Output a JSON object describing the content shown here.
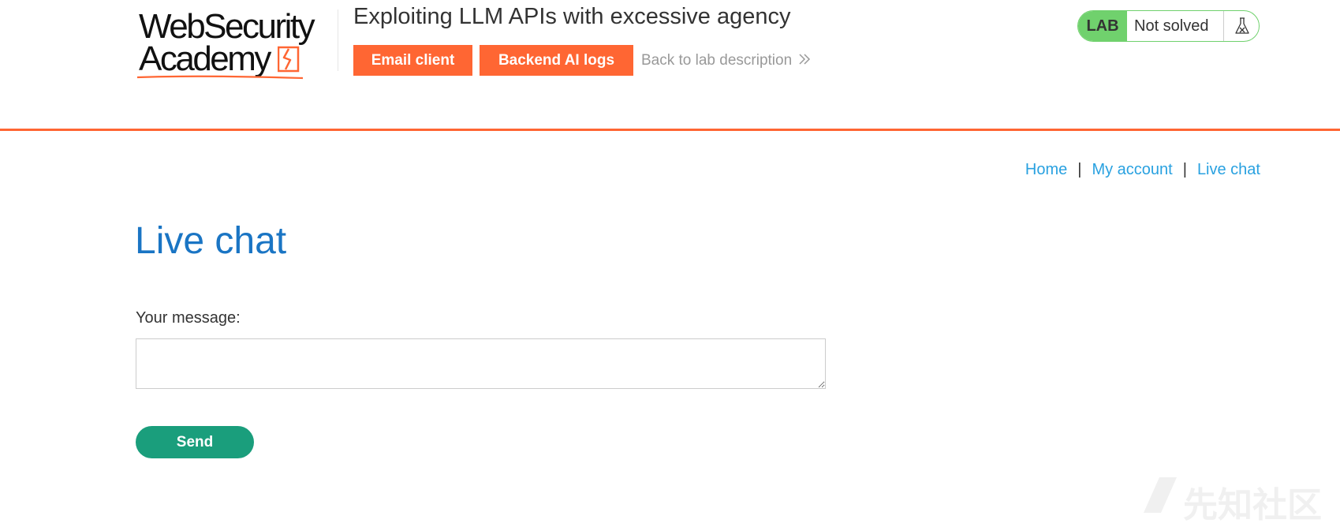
{
  "logo": {
    "line1": "WebSecurity",
    "line2": "Academy"
  },
  "header": {
    "lab_title": "Exploiting LLM APIs with excessive agency",
    "email_client_label": "Email client",
    "backend_logs_label": "Backend AI logs",
    "back_link_label": "Back to lab description"
  },
  "lab_status": {
    "badge": "LAB",
    "status": "Not solved"
  },
  "nav": {
    "home": "Home",
    "my_account": "My account",
    "live_chat": "Live chat",
    "separator": "|"
  },
  "main": {
    "title": "Live chat",
    "message_label": "Your message:",
    "message_value": "",
    "send_label": "Send"
  },
  "watermark": {
    "text": "先知社区"
  },
  "colors": {
    "accent": "#ff6633",
    "lab_green": "#70d16d",
    "link_blue": "#29a1e0",
    "title_blue": "#1a75c4",
    "send_green": "#1a9e7c"
  }
}
